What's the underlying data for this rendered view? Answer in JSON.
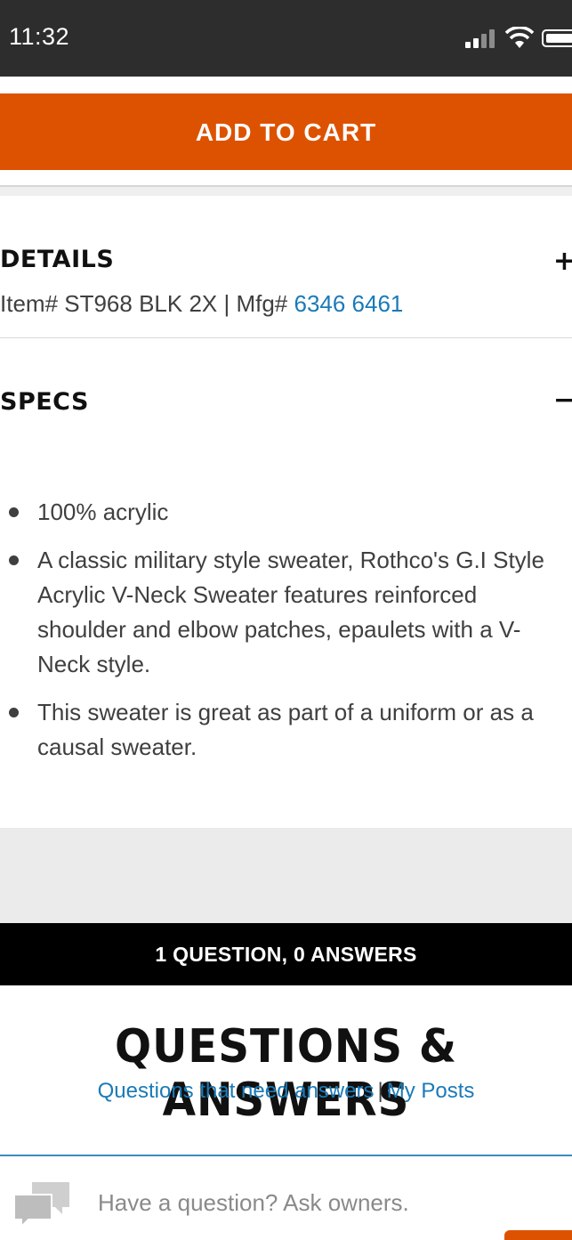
{
  "status_bar": {
    "time": "11:32"
  },
  "cart": {
    "button_label": "ADD TO CART"
  },
  "details": {
    "title": "DETAILS",
    "toggle": "+",
    "item_prefix": "Item# ST968 BLK 2X | Mfg# ",
    "mfg_number": "6346 6461"
  },
  "specs": {
    "title": "SPECS",
    "toggle": "−",
    "items": [
      "100% acrylic",
      "A classic military style sweater, Rothco's G.I Style Acrylic V-Neck Sweater features reinforced shoulder and elbow patches, epaulets with a V-Neck style.",
      "This sweater is great as part of a uniform or as a causal sweater."
    ]
  },
  "qa": {
    "summary": "1 QUESTION, 0 ANSWERS",
    "title": "QUESTIONS & ANSWERS",
    "link_need_answers": "Questions that need answers",
    "separator": "|",
    "link_my_posts": "My Posts",
    "ask_placeholder": "Have a question? Ask owners."
  },
  "colors": {
    "accent": "#dd5200",
    "link": "#1a7ab8",
    "status_bar": "#2d2d2d"
  }
}
